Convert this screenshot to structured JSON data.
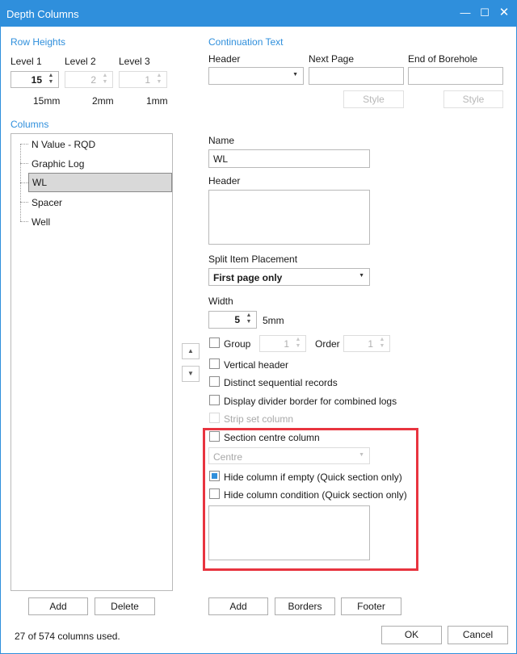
{
  "window": {
    "title": "Depth Columns"
  },
  "row_heights": {
    "title": "Row Heights",
    "levels": [
      {
        "label": "Level 1",
        "value": "15",
        "mm": "15mm",
        "enabled": true
      },
      {
        "label": "Level 2",
        "value": "2",
        "mm": "2mm",
        "enabled": false
      },
      {
        "label": "Level 3",
        "value": "1",
        "mm": "1mm",
        "enabled": false
      }
    ]
  },
  "continuation": {
    "title": "Continuation Text",
    "header_label": "Header",
    "header_value": "",
    "next_page_label": "Next Page",
    "next_page_value": "",
    "end_label": "End of Borehole",
    "end_value": "",
    "style_label": "Style"
  },
  "columns": {
    "title": "Columns",
    "items": [
      "N Value - RQD",
      "Graphic Log",
      "WL",
      "Spacer",
      "Well"
    ],
    "selected_index": 2,
    "add_label": "Add",
    "delete_label": "Delete"
  },
  "details": {
    "name_label": "Name",
    "name_value": "WL",
    "header_label": "Header",
    "header_value": "",
    "split_label": "Split Item Placement",
    "split_value": "First page only",
    "width_label": "Width",
    "width_value": "5",
    "width_mm": "5mm",
    "group_label": "Group",
    "group_value": "1",
    "order_label": "Order",
    "order_value": "1",
    "vertical_header": "Vertical header",
    "distinct_records": "Distinct sequential records",
    "display_divider": "Display divider border for combined logs",
    "strip_set": "Strip set column",
    "section_centre": "Section centre column",
    "centre_value": "Centre",
    "hide_if_empty": "Hide column if empty (Quick section only)",
    "hide_if_empty_checked": true,
    "hide_condition": "Hide column condition (Quick section only)",
    "condition_value": "",
    "add_label": "Add",
    "borders_label": "Borders",
    "footer_label": "Footer"
  },
  "status": "27 of 574 columns used.",
  "ok_label": "OK",
  "cancel_label": "Cancel",
  "colors": {
    "accent": "#2f8fdc",
    "highlight": "#e8343f"
  }
}
